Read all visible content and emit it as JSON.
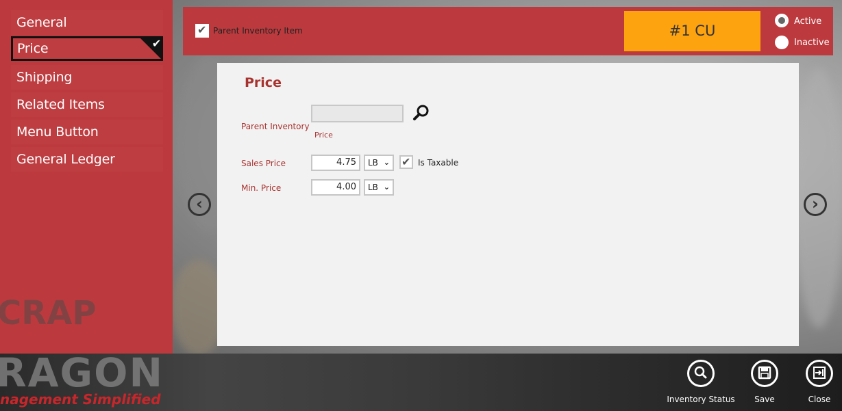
{
  "sidebar": {
    "items": [
      {
        "label": "General"
      },
      {
        "label": "Price"
      },
      {
        "label": "Shipping"
      },
      {
        "label": "Related Items"
      },
      {
        "label": "Menu Button"
      },
      {
        "label": "General Ledger"
      }
    ],
    "selected": "Price"
  },
  "topbar": {
    "parent_inventory_item_label": "Parent Inventory Item",
    "parent_inventory_item_checked": true,
    "item_code": "#1 CU",
    "status_active_label": "Active",
    "status_inactive_label": "Inactive",
    "status_selected": "Active"
  },
  "panel": {
    "title": "Price",
    "parent_inventory": {
      "label": "Parent Inventory",
      "value": "",
      "sub_label": "Price"
    },
    "sales_price": {
      "label": "Sales Price",
      "value": "4.75",
      "unit": "LB",
      "is_taxable_label": "Is Taxable",
      "is_taxable_checked": true
    },
    "min_price": {
      "label": "Min. Price",
      "value": "4.00",
      "unit": "LB"
    }
  },
  "appbar": {
    "inventory_status_label": "Inventory Status",
    "save_label": "Save",
    "close_label": "Close"
  },
  "brand": {
    "watermark": "CRAP",
    "name": "RAGON",
    "tagline": "nagement Simplified"
  },
  "colors": {
    "accent": "#bc3a3e",
    "orange": "#fca30f",
    "label_red": "#a8322e"
  }
}
